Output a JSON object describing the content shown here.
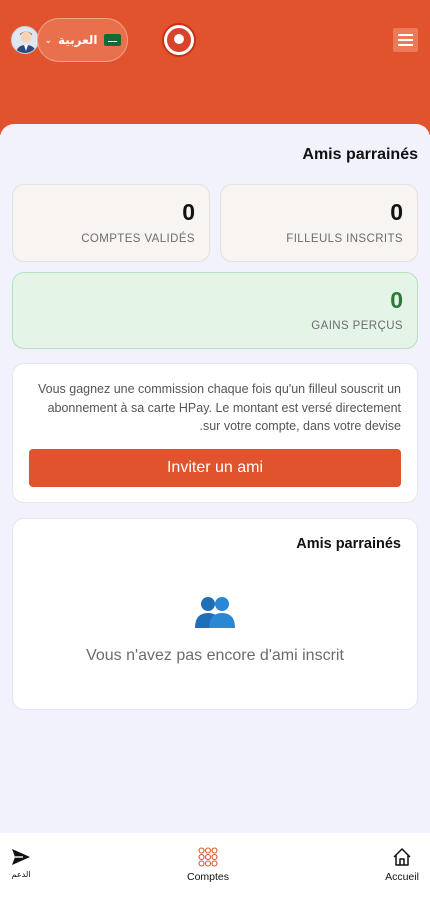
{
  "header": {
    "language_label": "العربية",
    "language_flag_icon": "saudi-flag-icon",
    "avatar_icon": "user-avatar-icon",
    "logo_icon": "brand-logo-icon",
    "menu_icon": "hamburger-menu-icon",
    "chevron_icon": "chevron-down-icon",
    "brand_color": "#e1532c"
  },
  "page": {
    "title": "Amis parrainés"
  },
  "stats": {
    "referred_count": "0",
    "referred_label": "FILLEULS INSCRITS",
    "validated_count": "0",
    "validated_label": "COMPTES VALIDÉS",
    "earnings_value": "0",
    "earnings_label": "GAINS PERÇUS",
    "earnings_color": "#2a7a3b"
  },
  "info": {
    "text": "Vous gagnez une commission chaque fois qu'un filleul souscrit un abonnement à sa carte HPay. Le montant est versé directement sur votre compte, dans votre devise.",
    "invite_button_label": "Inviter un ami"
  },
  "friends": {
    "title": "Amis parrainés",
    "icon": "people-icon",
    "empty_message": "Vous n'avez pas encore d'ami inscrit"
  },
  "bottom_nav": {
    "items": [
      {
        "label": "الدعم",
        "icon": "send-icon"
      },
      {
        "label": "Comptes",
        "icon": "grid-dots-icon",
        "active_color": "#e1532c"
      },
      {
        "label": "Accueil",
        "icon": "home-icon"
      }
    ]
  }
}
